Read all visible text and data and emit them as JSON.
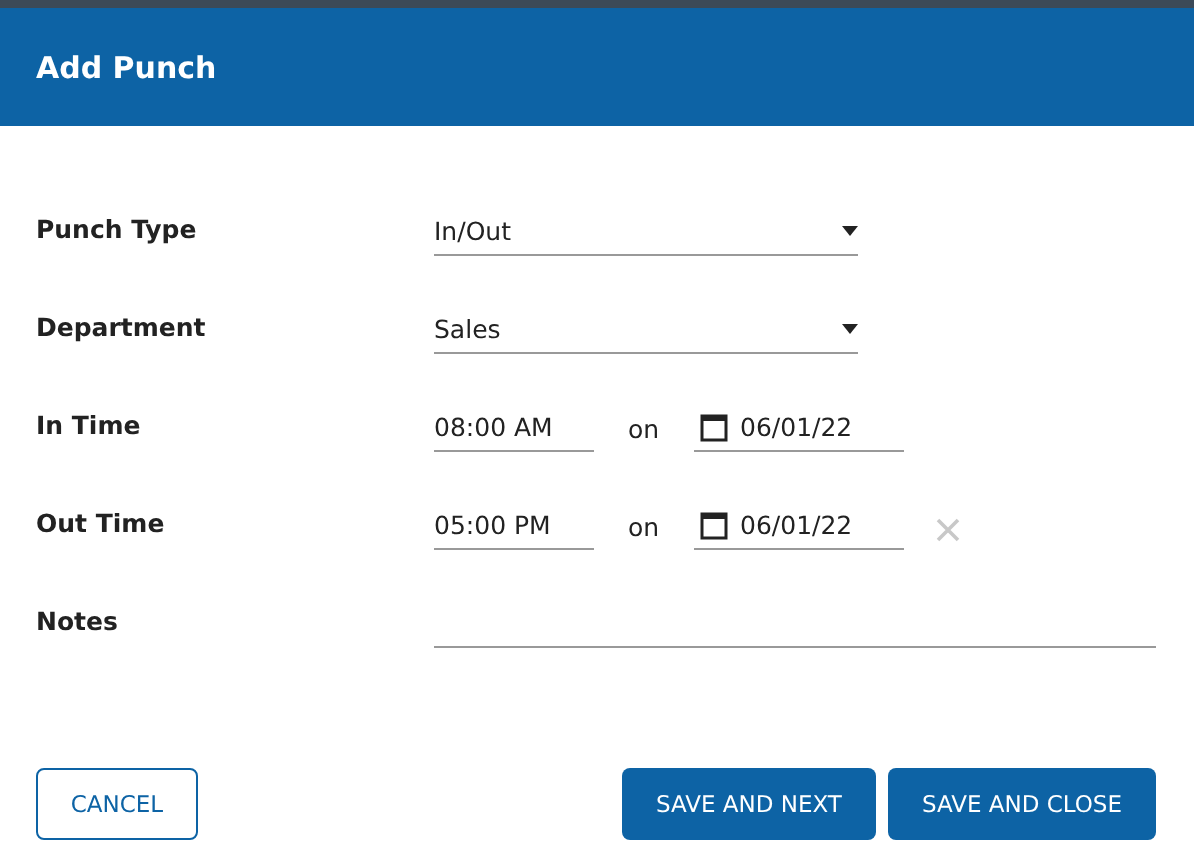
{
  "dialog": {
    "title": "Add Punch"
  },
  "fields": [
    {
      "kind": "select",
      "label": "Punch Type",
      "value": "In/Out"
    },
    {
      "kind": "select",
      "label": "Department",
      "value": "Sales"
    },
    {
      "kind": "datetime",
      "label": "In Time",
      "time": "08:00 AM",
      "joiner": "on",
      "date": "06/01/22",
      "clearable": false
    },
    {
      "kind": "datetime",
      "label": "Out Time",
      "time": "05:00 PM",
      "joiner": "on",
      "date": "06/01/22",
      "clearable": true
    },
    {
      "kind": "text",
      "label": "Notes"
    }
  ],
  "buttons": [
    {
      "kind": "outline",
      "label": "CANCEL"
    },
    {
      "kind": "primary",
      "label": "SAVE AND NEXT"
    },
    {
      "kind": "primary",
      "label": "SAVE AND CLOSE"
    }
  ]
}
